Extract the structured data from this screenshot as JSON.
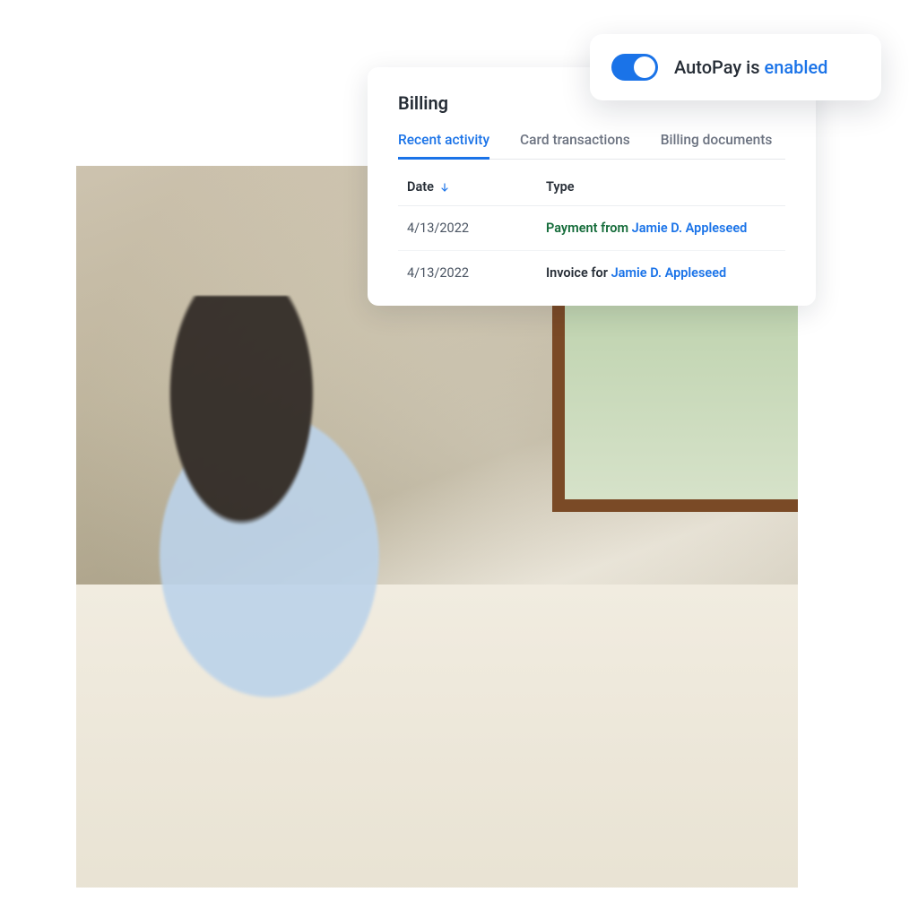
{
  "autopay": {
    "label_prefix": "AutoPay is ",
    "status_word": "enabled",
    "on": true
  },
  "billing": {
    "title": "Billing",
    "tabs": [
      {
        "label": "Recent activity",
        "active": true
      },
      {
        "label": "Card transactions",
        "active": false
      },
      {
        "label": "Billing documents",
        "active": false
      }
    ],
    "columns": {
      "date": "Date",
      "type": "Type"
    },
    "rows": [
      {
        "date": "4/13/2022",
        "kind": "payment",
        "prefix": "Payment from ",
        "link": "Jamie D. Appleseed"
      },
      {
        "date": "4/13/2022",
        "kind": "invoice",
        "prefix": "Invoice for ",
        "link": "Jamie D. Appleseed"
      }
    ]
  },
  "colors": {
    "accent": "#1a73e8",
    "success": "#156c3a"
  }
}
